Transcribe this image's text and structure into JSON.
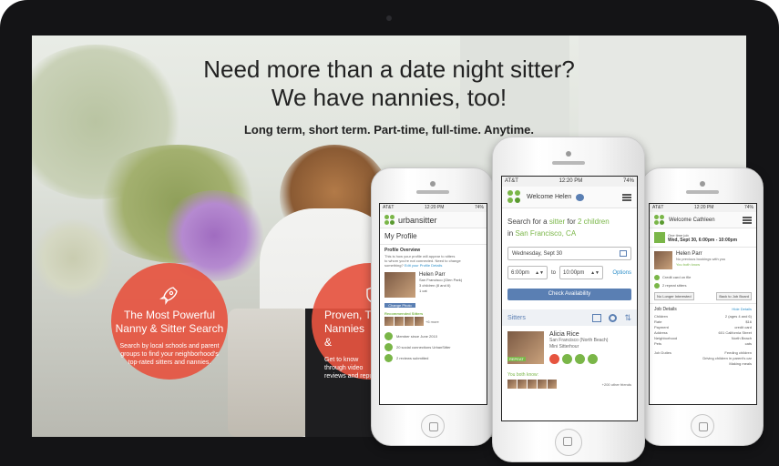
{
  "hero": {
    "line1": "Need more than a date night sitter?",
    "line2": "We have nannies, too!",
    "subline": "Long term, short term. Part-time, full-time. Anytime."
  },
  "feature1": {
    "title1": "The Most Powerful",
    "title2": "Nanny & Sitter Search",
    "body1": "Search by local schools and parent",
    "body2": "groups to find your neighborhood's",
    "body3": "top-rated sitters and nannies."
  },
  "feature2": {
    "title1": "Proven, T",
    "title2": "Nannies &",
    "body1": "Get to know",
    "body2": "through video",
    "body3": "reviews and repu"
  },
  "phone_left": {
    "carrier": "AT&T",
    "time": "12:20 PM",
    "battery": "74%",
    "brand": "urbansitter",
    "page_title": "My Profile",
    "section": "Profile Overview",
    "notice1": "This is how your profile will appear to sitters",
    "notice2": "to whom you're not connected. Need to change",
    "notice3": "something?",
    "notice_link": "Edit your Profile Details",
    "name": "Helen Parr",
    "location": "San Francisco (Glen Park)",
    "children": "3 children (8 and 6)",
    "cats": "1 cat",
    "change_photo": "Change Photo",
    "recommended": "Recommended Sitters",
    "more": "+6 more",
    "member_since": "Member since June 2010",
    "social": "20 social connections UrbanSitter",
    "reviews": "2 reviews submitted"
  },
  "phone_center": {
    "carrier": "AT&T",
    "time": "12:20 PM",
    "battery": "74%",
    "welcome": "Welcome Helen",
    "search_prefix": "Search for a",
    "search_mid1": "sitter",
    "search_mid2": "for",
    "search_children": "2 children",
    "search_in": "in",
    "search_city": "San Francisco, CA",
    "date_value": "Wednesday, Sept 30",
    "time_from": "6:00pm",
    "time_to_label": "to",
    "time_to": "10:00pm",
    "options": "Options",
    "check_button": "Check Availability",
    "sitters_label": "Sitters",
    "sitter_name": "Alicia Rice",
    "sitter_loc": "San Francisco (North Beach)",
    "sitter_sub": "Mini Sitterhour",
    "badge": "REPEAT",
    "you_both_know": "You both know:",
    "more_friends": "+200 other friends"
  },
  "phone_right": {
    "carrier": "AT&T",
    "time": "12:20 PM",
    "battery": "74%",
    "welcome": "Welcome Cathleen",
    "job_type": "One time job",
    "job_when": "Wed, Sept 30, 6:00pm - 10:00pm",
    "name": "Helen Parr",
    "prev": "No previous bookings with you",
    "fav": "You both know",
    "card": "Credit card on file",
    "repeat": "2 repeat sitters",
    "btn_no": "No Longer Interested",
    "btn_back": "Back to Job Board",
    "details": "Job Details",
    "hide": "Hide Details",
    "rows": [
      {
        "k": "Children",
        "v": "2 (ages 4 and 6)"
      },
      {
        "k": "Rate",
        "v": "$16"
      },
      {
        "k": "Payment",
        "v": "credit card"
      },
      {
        "k": "Address",
        "v": "601 California Street"
      },
      {
        "k": "Neighborhood",
        "v": "North Beach"
      },
      {
        "k": "Pets",
        "v": "cats"
      }
    ],
    "duties": "Job Duties",
    "duty1": "Feeding children",
    "duty2": "Driving children in parent's car",
    "duty3": "Making meals"
  }
}
